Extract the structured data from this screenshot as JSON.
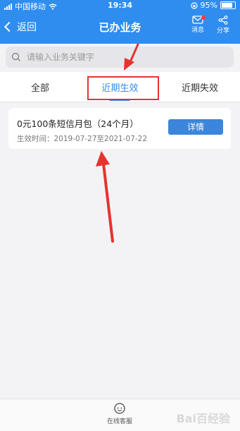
{
  "status_bar": {
    "carrier": "中国移动",
    "time": "19:34",
    "battery": "95%",
    "battery_level": 0.95
  },
  "nav": {
    "back_label": "返回",
    "title": "已办业务",
    "message_label": "消息",
    "share_label": "分享"
  },
  "search": {
    "placeholder": "请输入业务关键字",
    "value": ""
  },
  "tabs": [
    {
      "label": "全部",
      "active": false
    },
    {
      "label": "近期生效",
      "active": true
    },
    {
      "label": "近期失效",
      "active": false
    }
  ],
  "items": [
    {
      "name": "0元100条短信月包（24个月）",
      "effective_time": "生效时间：2019-07-27至2021-07-22",
      "button_label": "详情"
    }
  ],
  "bottom": {
    "service_label": "在线客服",
    "watermark": "Bai百经验"
  },
  "colors": {
    "brand_blue": "#2f8df0",
    "button_blue": "#3b86dc",
    "annotation_red": "#e8322f",
    "background_gray": "#f3f3f5"
  }
}
